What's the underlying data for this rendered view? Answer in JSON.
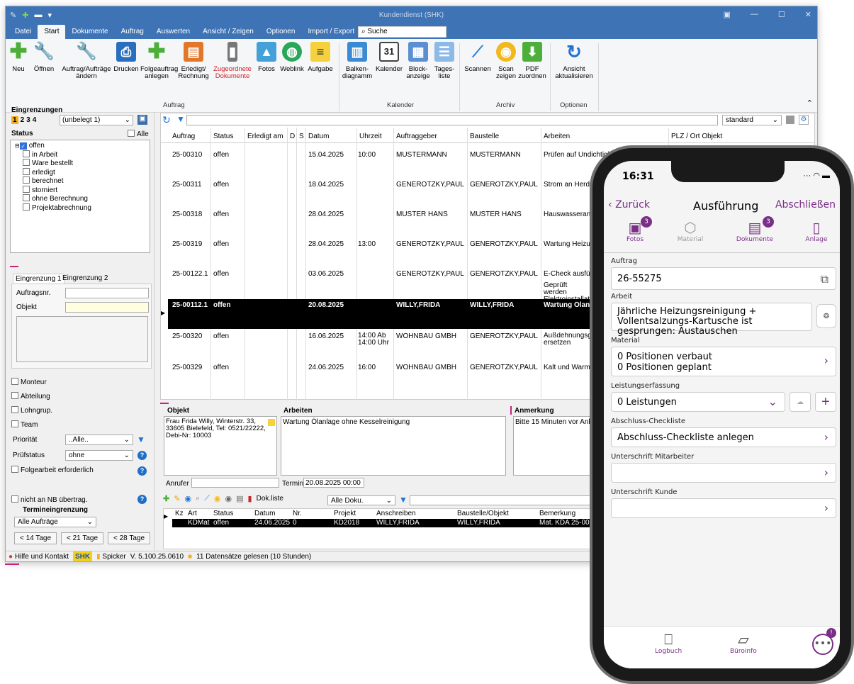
{
  "app": {
    "title": "Kundendienst (SHK)"
  },
  "menu": [
    "Datei",
    "Start",
    "Dokumente",
    "Auftrag",
    "Auswerten",
    "Ansicht / Zeigen",
    "Optionen",
    "Import / Export"
  ],
  "menu_search": "Suche",
  "ribbon": {
    "buttons": [
      "Neu",
      "Öffnen",
      "Auftrag/Aufträge ändern",
      "Drucken",
      "Folgeauftrag anlegen",
      "Erledigt/ Rechnung",
      "Zugeordnete Dokumente",
      "Fotos",
      "Weblink",
      "Aufgabe",
      "Balken- diagramm",
      "Kalender",
      "Block- anzeige",
      "Tages- liste",
      "Scannen",
      "Scan zeigen",
      "PDF zuordnen",
      "Ansicht aktualisieren"
    ],
    "groups": [
      "Auftrag",
      "Kalender",
      "Archiv",
      "Optionen"
    ],
    "calendar_number": "31"
  },
  "left": {
    "eingrenzungen": "Eingrenzungen",
    "tabs_nums": [
      "1",
      "2",
      "3",
      "4"
    ],
    "unbelegt": "(unbelegt 1)",
    "status_label": "Status",
    "alle": "Alle",
    "status_items": [
      "offen",
      "in Arbeit",
      "Ware bestellt",
      "erledigt",
      "berechnet",
      "storniert",
      "ohne Berechnung",
      "Projektabrechnung"
    ],
    "etabs": [
      "Eingrenzung 1",
      "Eingrenzung 2"
    ],
    "auftragsnr": "Auftragsnr.",
    "objekt": "Objekt",
    "checks": [
      "Monteur",
      "Abteilung",
      "Lohngrup.",
      "Team"
    ],
    "prioritaet": "Priorität",
    "prioritaet_val": "..Alle..",
    "pruefstatus": "Prüfstatus",
    "pruefstatus_val": "ohne",
    "folgearbeit": "Folgearbeit erforderlich",
    "nb": "nicht an NB übertrag.",
    "termin": "Termineingrenzung",
    "termin_val": "Alle Aufträge",
    "range_btns": [
      "< 14 Tage",
      "< 21 Tage",
      "< 28 Tage"
    ]
  },
  "grid": {
    "view": "standard",
    "columns": [
      "Auftrag",
      "Status",
      "Erledigt am",
      "D",
      "S",
      "Datum",
      "Uhrzeit",
      "Auftraggeber",
      "Baustelle",
      "Arbeiten",
      "PLZ / Ort Objekt"
    ],
    "rows": [
      [
        "25-00310",
        "offen",
        "",
        "15.04.2025",
        "10:00",
        "MUSTERMANN",
        "MUSTERMANN",
        "Prüfen auf Undichtigkeit",
        ""
      ],
      [
        "25-00311",
        "offen",
        "",
        "18.04.2025",
        "",
        "GENEROTZKY,PAUL",
        "GENEROTZKY,PAUL",
        "Strom an Herdpl",
        ""
      ],
      [
        "25-00318",
        "offen",
        "",
        "28.04.2025",
        "",
        "MUSTER HANS",
        "MUSTER HANS",
        "Hauswasserans",
        ""
      ],
      [
        "25-00319",
        "offen",
        "",
        "28.04.2025",
        "13:00",
        "GENEROTZKY,PAUL",
        "GENEROTZKY,PAUL",
        "Wartung Heizun",
        ""
      ],
      [
        "25-00122.1",
        "offen",
        "",
        "03.06.2025",
        "",
        "GENEROTZKY,PAUL",
        "GENEROTZKY,PAUL",
        "E-Check ausfüh",
        "Geprüft werden Elektroinstallati"
      ],
      [
        "25-00112.1",
        "offen",
        "",
        "20.08.2025",
        "",
        "WILLY,FRIDA",
        "WILLY,FRIDA",
        "Wartung Ölanl",
        ""
      ],
      [
        "25-00320",
        "offen",
        "",
        "16.06.2025",
        "14:00 Ab 14:00 Uhr",
        "WOHNBAU GMBH",
        "GENEROTZKY,PAUL",
        "Außdehnungsge ersetzen",
        ""
      ],
      [
        "25-00329",
        "offen",
        "",
        "24.06.2025",
        "16:00",
        "WOHNBAU GMBH",
        "GENEROTZKY,PAUL",
        "Kalt und Warmw",
        ""
      ]
    ]
  },
  "detail": {
    "objekt_label": "Objekt",
    "objekt_text": "Frau Frida Willy, Winterstr. 33, 33605 Bielefeld, Tel: 0521/22222, Debi-Nr: 10003",
    "arbeiten_label": "Arbeiten",
    "arbeiten_text": "Wartung Ölanlage ohne Kesselreinigung",
    "anmerkung_label": "Anmerkung",
    "anmerkung_text": "Bitte 15 Minuten vor Anku",
    "anrufer": "Anrufer",
    "termin": "Termin",
    "termin_val": "20.08.2025 00:00"
  },
  "docs": {
    "dokliste": "Dok.liste",
    "filter": "Alle Doku.",
    "columns": [
      "Kz",
      "Art",
      "Status",
      "Datum",
      "Nr.",
      "Projekt",
      "Anschreiben",
      "Baustelle/Objekt",
      "Bemerkung"
    ],
    "row": [
      "",
      "KDMat",
      "offen",
      "24.06.2025",
      "0",
      "KD2018",
      "WILLY,FRIDA",
      "WILLY,FRIDA",
      "Mat. KDA 25-001"
    ]
  },
  "statusbar": [
    "Hilfe und Kontakt",
    "SHK",
    "Spicker",
    "V. 5.100.25.0610",
    "11 Datensätze gelesen (10 Stunden)"
  ],
  "phone": {
    "time": "16:31",
    "back": "Zurück",
    "title": "Ausführung",
    "finish": "Abschließen",
    "tabs": [
      {
        "label": "Fotos",
        "badge": "3"
      },
      {
        "label": "Material",
        "badge": ""
      },
      {
        "label": "Dokumente",
        "badge": "3"
      },
      {
        "label": "Anlage",
        "badge": ""
      }
    ],
    "auftrag_label": "Auftrag",
    "auftrag": "26-55275",
    "arbeit_label": "Arbeit",
    "arbeit": "Jährliche Heizungsreinigung + Vollentsalzungs-Kartusche ist gesprungen: Austauschen",
    "material_label": "Material",
    "material_1": "0 Positionen verbaut",
    "material_2": "0 Positionen geplant",
    "leistung_label": "Leistungserfassung",
    "leistung": "0 Leistungen",
    "checkliste_label": "Abschluss-Checkliste",
    "checkliste": "Abschluss-Checkliste anlegen",
    "sig_ma_label": "Unterschrift Mitarbeiter",
    "sig_kunde_label": "Unterschrift Kunde",
    "bottom": [
      "Logbuch",
      "Büroinfo"
    ],
    "more_badge": "!"
  }
}
